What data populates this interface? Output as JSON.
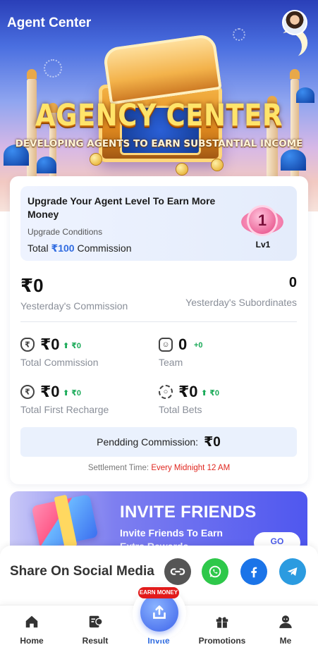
{
  "header": {
    "title": "Agent Center"
  },
  "hero": {
    "title": "AGENCY CENTER",
    "subtitle": "DEVELOPING AGENTS TO EARN SUBSTANTIAL INCOME"
  },
  "upgrade": {
    "title": "Upgrade Your Agent Level To Earn More Money",
    "conditions_label": "Upgrade Conditions",
    "total_prefix": "Total",
    "total_amount": "₹100",
    "total_suffix": "Commission",
    "badge_number": "1",
    "badge_label": "Lv1"
  },
  "summary": {
    "yesterday_commission": "₹0",
    "yesterday_commission_label": "Yesterday's Commission",
    "yesterday_subordinates": "0",
    "yesterday_subordinates_label": "Yesterday's Subordinates"
  },
  "stats": [
    {
      "value": "₹0",
      "delta": "⬆ ₹0",
      "label": "Total Commission",
      "icon": "money-bag-icon",
      "glyph": "₹"
    },
    {
      "value": "0",
      "delta": "+0",
      "label": "Team",
      "icon": "team-icon",
      "glyph": "☺"
    },
    {
      "value": "₹0",
      "delta": "⬆ ₹0",
      "label": "Total First Recharge",
      "icon": "rupee-coin-icon",
      "glyph": "₹"
    },
    {
      "value": "₹0",
      "delta": "⬆ ₹0",
      "label": "Total Bets",
      "icon": "bets-gear-icon",
      "glyph": "○"
    }
  ],
  "pending": {
    "label": "Pendding Commission:",
    "value": "₹0"
  },
  "settlement": {
    "label": "Settlement Time:",
    "time": "Every Midnight 12 AM"
  },
  "invite": {
    "title": "INVITE FRIENDS",
    "subtitle": "Invite Friends To Earn",
    "subtitle2": "Extra Rewards",
    "button": "GO"
  },
  "share": {
    "title": "Share On Social Media",
    "icons": [
      "link-icon",
      "whatsapp-icon",
      "facebook-icon",
      "telegram-icon"
    ]
  },
  "nav": {
    "items": [
      {
        "label": "Home",
        "icon": "home-icon"
      },
      {
        "label": "Result",
        "icon": "result-icon"
      },
      {
        "label": "Invite",
        "icon": "invite-upload-icon",
        "active": true
      },
      {
        "label": "Promotions",
        "icon": "gift-icon"
      },
      {
        "label": "Me",
        "icon": "profile-icon"
      }
    ],
    "earn_badge": "EARN MONEY"
  },
  "colors": {
    "accent_blue": "#2f6be0",
    "delta_green": "#1aaa58",
    "settlement_red": "#e0271f",
    "earn_badge_red": "#e21b1b",
    "whatsapp": "#2ec84a",
    "facebook": "#1b74e8",
    "telegram": "#2b9be0"
  }
}
